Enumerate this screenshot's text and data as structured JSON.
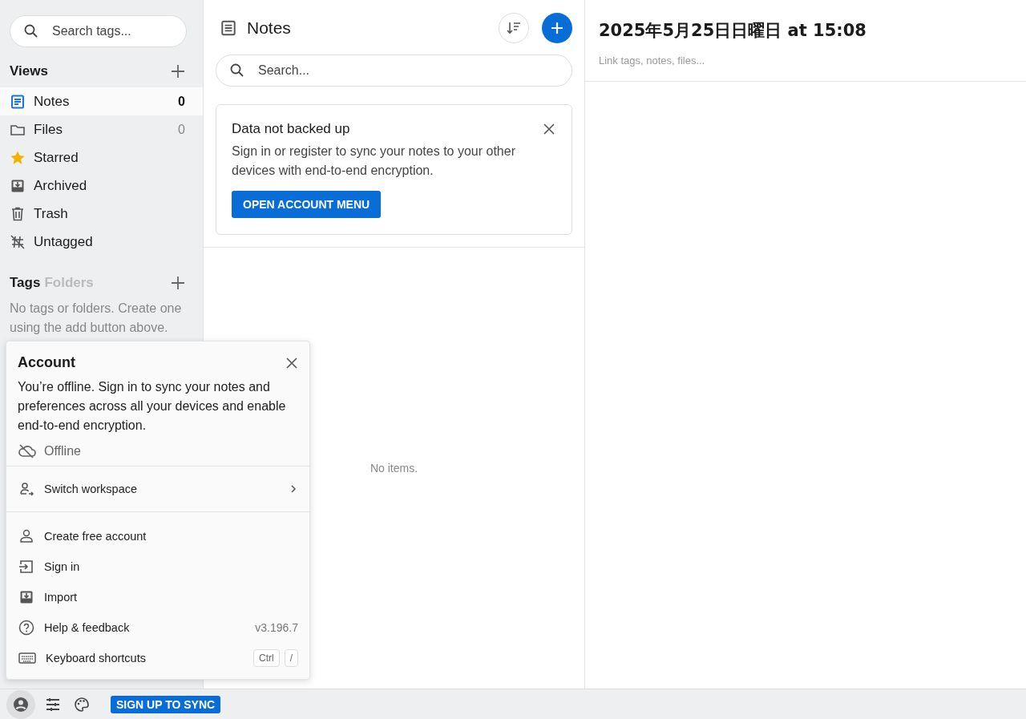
{
  "sidebar": {
    "search": {
      "placeholder": "Search tags..."
    },
    "views": {
      "title": "Views",
      "items": [
        {
          "kind": "notes",
          "label": "Notes",
          "count": "0",
          "selected": true
        },
        {
          "kind": "files",
          "label": "Files",
          "count": "0",
          "selected": false
        },
        {
          "kind": "starred",
          "label": "Starred",
          "selected": false
        },
        {
          "kind": "archived",
          "label": "Archived",
          "selected": false
        },
        {
          "kind": "trash",
          "label": "Trash",
          "selected": false
        },
        {
          "kind": "untagged",
          "label": "Untagged",
          "selected": false
        }
      ]
    },
    "tags": {
      "tabs": [
        {
          "label": "Tags",
          "selected": true
        },
        {
          "label": "Folders",
          "selected": false
        }
      ],
      "empty": "No tags or folders. Create one using the add button above."
    }
  },
  "notes_list": {
    "title": "Notes",
    "search": {
      "placeholder": "Search..."
    },
    "banner": {
      "title": "Data not backed up",
      "text": "Sign in or register to sync your notes to your other devices with end-to-end encryption.",
      "button": "OPEN ACCOUNT MENU"
    },
    "empty": "No items."
  },
  "editor": {
    "title": "2025年5月25日日曜日 at 15:08",
    "link_placeholder": "Link tags, notes, files..."
  },
  "account_menu": {
    "title": "Account",
    "text": "You’re offline. Sign in to sync your notes and preferences across all your devices and enable end-to-end encryption.",
    "status": "Offline",
    "workspace": {
      "label": "Switch workspace"
    },
    "items": [
      {
        "kind": "create",
        "label": "Create free account"
      },
      {
        "kind": "signin",
        "label": "Sign in"
      },
      {
        "kind": "import",
        "label": "Import"
      },
      {
        "kind": "help",
        "label": "Help & feedback",
        "detail": "v3.196.7"
      },
      {
        "kind": "keyboard",
        "label": "Keyboard shortcuts",
        "keys": [
          "Ctrl",
          "/"
        ]
      }
    ]
  },
  "footer": {
    "button": "SIGN UP TO SYNC"
  }
}
